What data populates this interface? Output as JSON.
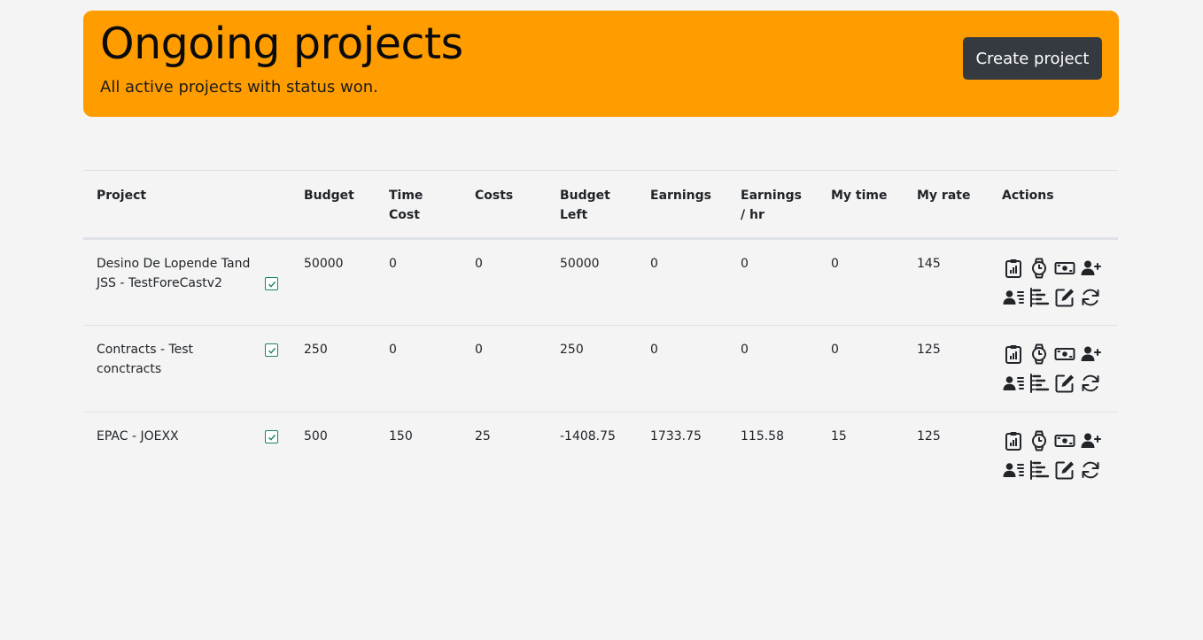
{
  "header": {
    "title": "Ongoing projects",
    "subtitle": "All active projects with status won.",
    "create_label": "Create project"
  },
  "table": {
    "columns": [
      "Project",
      "Budget",
      "Time Cost",
      "Costs",
      "Budget Left",
      "Earnings",
      "Earnings / hr",
      "My time",
      "My rate",
      "Actions"
    ],
    "rows": [
      {
        "project": "Desino De Lopende Tand JSS - TestForeCastv2",
        "budget": "50000",
        "time_cost": "0",
        "costs": "0",
        "budget_left": "50000",
        "earnings": "0",
        "earnings_hr": "0",
        "my_time": "0",
        "my_rate": "145"
      },
      {
        "project": "Contracts - Test conctracts",
        "budget": "250",
        "time_cost": "0",
        "costs": "0",
        "budget_left": "250",
        "earnings": "0",
        "earnings_hr": "0",
        "my_time": "0",
        "my_rate": "125"
      },
      {
        "project": "EPAC - JOEXX",
        "budget": "500",
        "time_cost": "150",
        "costs": "25",
        "budget_left": "-1408.75",
        "earnings": "1733.75",
        "earnings_hr": "115.58",
        "my_time": "15",
        "my_rate": "125"
      }
    ]
  },
  "actions_icons": [
    "clipboard-chart-icon",
    "watch-icon",
    "money-icon",
    "add-user-icon",
    "user-list-icon",
    "tree-list-icon",
    "edit-icon",
    "refresh-icon"
  ],
  "colors": {
    "hero": "#ff9c00",
    "button": "#343a40",
    "check": "#198754"
  }
}
